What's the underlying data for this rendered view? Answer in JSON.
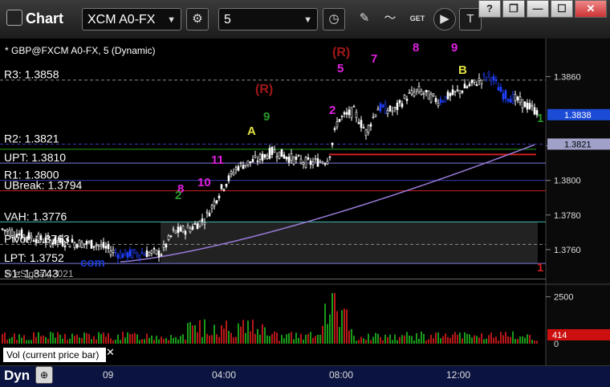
{
  "window": {
    "title": "Chart",
    "symbol": "XCM A0-FX",
    "interval": "5",
    "controls": {
      "help": "?",
      "restore": "❐",
      "minimize": "—",
      "maximize": "☐",
      "close": "✕"
    }
  },
  "toolbar": [
    {
      "name": "settings-gear-icon",
      "glyph": "⚙"
    },
    {
      "name": "clock-icon",
      "glyph": "◷"
    },
    {
      "name": "pencil-icon",
      "glyph": "✎"
    },
    {
      "name": "study-icon",
      "glyph": "〜"
    },
    {
      "name": "get-icon",
      "glyph": "GET"
    },
    {
      "name": "play-icon",
      "glyph": "▶"
    },
    {
      "name": "text-tool-icon",
      "glyph": "T"
    }
  ],
  "chart_data": {
    "type": "candlestick",
    "title": "* GBP@FXCM A0-FX, 5 (Dynamic)",
    "copyright": "© eSignal, 2021",
    "price_axis": {
      "min": 1.3743,
      "max": 1.3878,
      "ticks": [
        "1.3860",
        "1.3820",
        "1.3800",
        "1.3780",
        "1.3760"
      ],
      "tick_values": [
        1.386,
        1.382,
        1.38,
        1.378,
        1.376
      ]
    },
    "time_axis": {
      "ticks": [
        "09",
        "04:00",
        "08:00",
        "12:00"
      ]
    },
    "levels": [
      {
        "label": "R3: 1.3858",
        "value": 1.3858,
        "color": "#888888",
        "dash": true
      },
      {
        "label": "R2: 1.3821",
        "value": 1.3821,
        "color": "#3a3ab0",
        "dash": true
      },
      {
        "label": "UPT: 1.3810",
        "value": 1.381,
        "color": "#7b7bdb",
        "dash": false
      },
      {
        "label": "R1: 1.3800",
        "value": 1.38,
        "color": "#3a3ab0",
        "dash": false
      },
      {
        "label": "UBreak: 1.3794",
        "value": 1.3794,
        "color": "#cc1f1f",
        "dash": false
      },
      {
        "label": "VAH: 1.3776",
        "value": 1.3776,
        "color": "#3fb8b0",
        "dash": false
      },
      {
        "label": "Pivot: 1.3763",
        "value": 1.3763,
        "color": "#8a8a8a",
        "dash": true
      },
      {
        "label": "LPT: 1.3752",
        "value": 1.3752,
        "color": "#7b7bdb",
        "dash": false
      },
      {
        "label": "S1: 1.3743",
        "value": 1.3743,
        "color": "#666666",
        "dash": false
      }
    ],
    "price_badges": [
      {
        "label": "1.3838",
        "value": 1.3838,
        "bg": "#1c4bd6",
        "fg": "#ffffff"
      },
      {
        "label": "1.3821",
        "value": 1.3821,
        "bg": "#a0a0c8",
        "fg": "#000000"
      }
    ],
    "volume": {
      "label": "Vol (current price bar)",
      "ticks": [
        "2500",
        "0"
      ],
      "last_badge": "414",
      "max": 3000
    },
    "annotations": [
      {
        "text": "(R)",
        "color": "#a01818"
      },
      {
        "text": "(R)",
        "color": "#a01818"
      },
      {
        "text": "5",
        "color": "#e020e0"
      },
      {
        "text": "7",
        "color": "#e020e0"
      },
      {
        "text": "8",
        "color": "#e020e0"
      },
      {
        "text": "9",
        "color": "#e020e0"
      },
      {
        "text": "B",
        "color": "#e0e040"
      },
      {
        "text": "A",
        "color": "#e0e040"
      },
      {
        "text": "10",
        "color": "#e020e0"
      },
      {
        "text": "11",
        "color": "#e020e0"
      },
      {
        "text": "8",
        "color": "#e020e0"
      },
      {
        "text": "2",
        "color": "#e020e0"
      },
      {
        "text": "9",
        "color": "#2a9a2a"
      },
      {
        "text": "2",
        "color": "#2a9a2a"
      },
      {
        "text": "1",
        "color": "#2a9a2a"
      },
      {
        "text": "1",
        "color": "#cc2020"
      },
      {
        "text": "com",
        "color": "#1c3cd6"
      }
    ]
  },
  "bottom_bar": {
    "mode": "Dyn"
  }
}
